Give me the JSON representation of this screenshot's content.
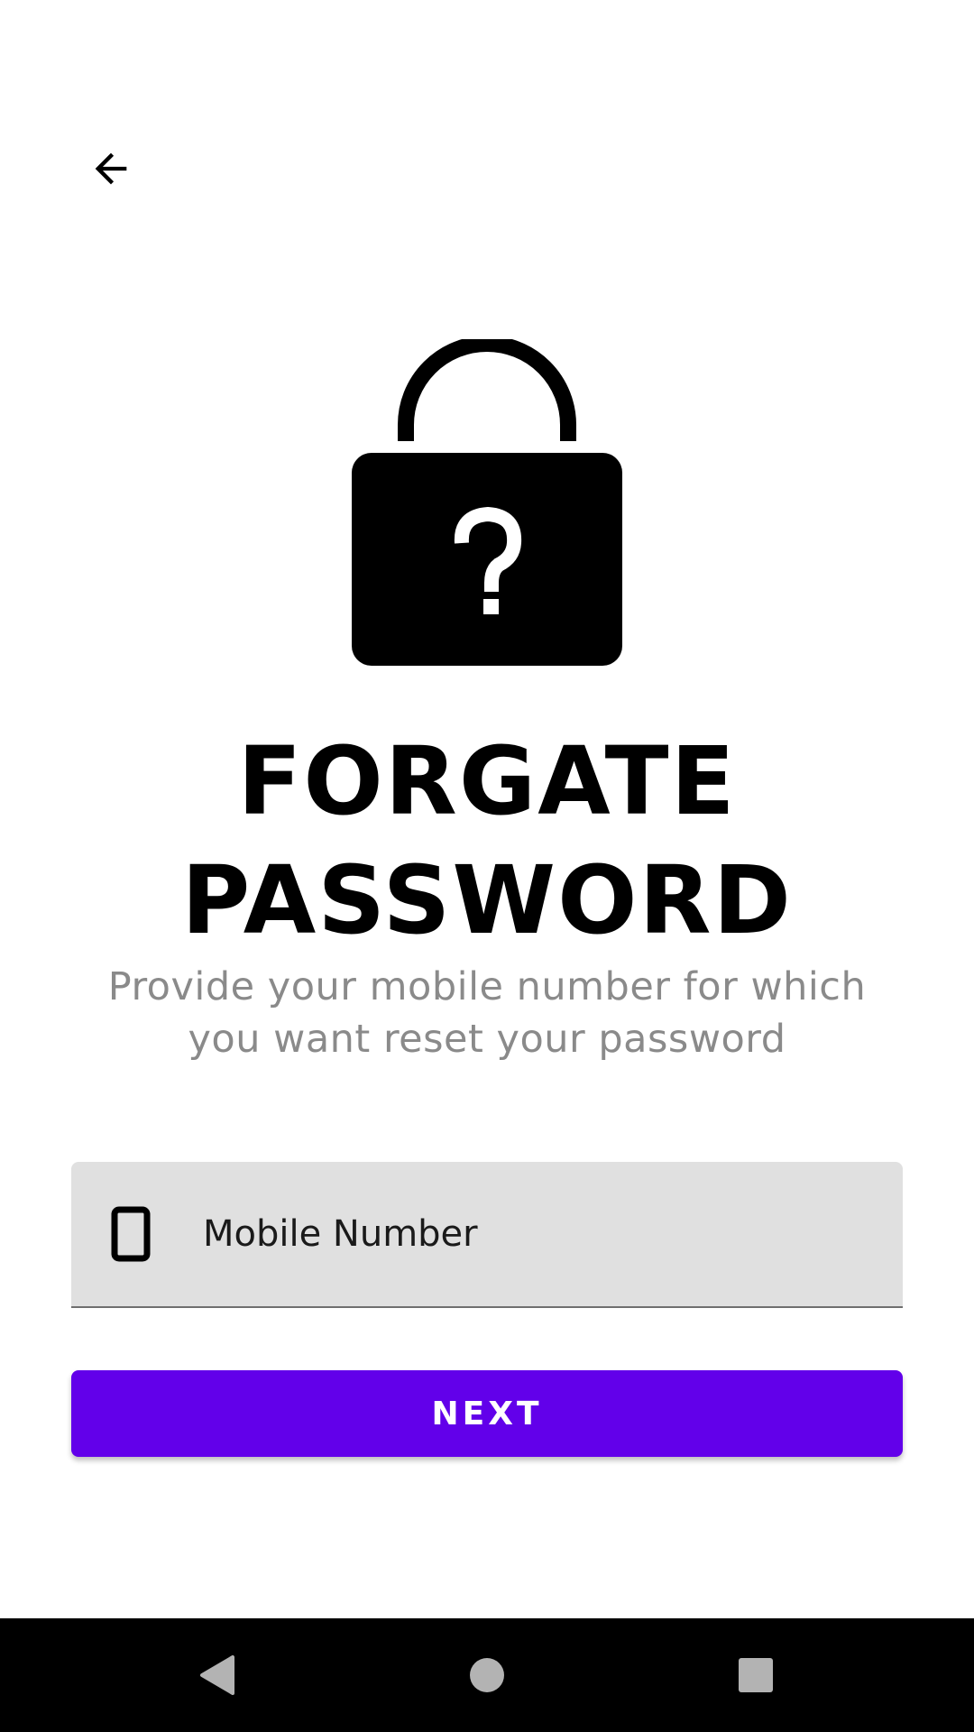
{
  "header": {
    "back_icon": "arrow-left-icon"
  },
  "hero": {
    "icon": "lock-question-icon",
    "title_line1": "FORGATE",
    "title_line2": "PASSWORD",
    "subtitle": "Provide your mobile number for which you want reset your password"
  },
  "form": {
    "mobile_icon": "smartphone-icon",
    "mobile_placeholder": "Mobile Number",
    "mobile_value": "",
    "next_label": "NEXT"
  },
  "navigation_bar": {
    "back_icon": "nav-back-triangle-icon",
    "home_icon": "nav-home-circle-icon",
    "recents_icon": "nav-recents-square-icon"
  },
  "colors": {
    "accent": "#6200ea",
    "field_background": "#e0e0e0",
    "subtitle_text": "#8a8a8a",
    "nav_background": "#000000",
    "nav_icons": "#b3b3b3"
  }
}
